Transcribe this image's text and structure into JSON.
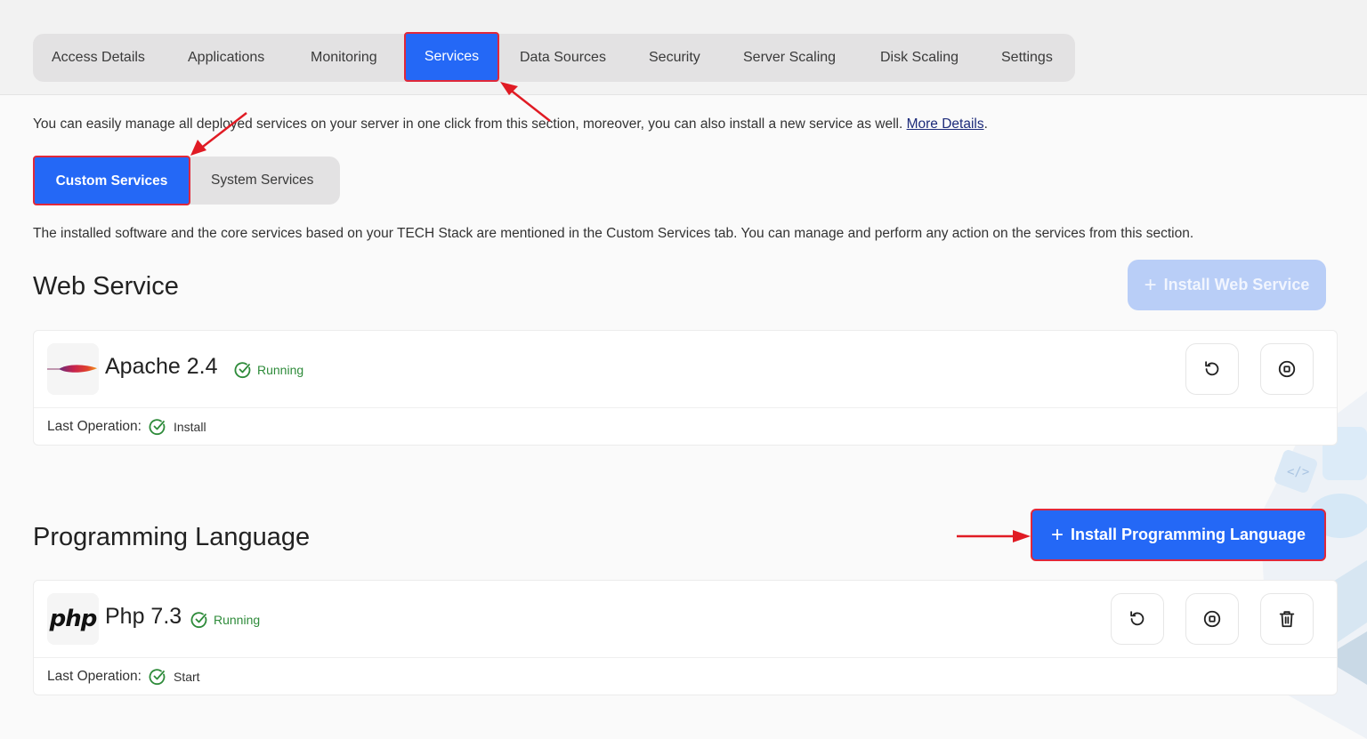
{
  "tabs": [
    {
      "label": "Access Details",
      "active": false
    },
    {
      "label": "Applications",
      "active": false
    },
    {
      "label": "Monitoring",
      "active": false
    },
    {
      "label": "Services",
      "active": true
    },
    {
      "label": "Data Sources",
      "active": false
    },
    {
      "label": "Security",
      "active": false
    },
    {
      "label": "Server Scaling",
      "active": false
    },
    {
      "label": "Disk Scaling",
      "active": false
    },
    {
      "label": "Settings",
      "active": false
    }
  ],
  "intro": {
    "text": "You can easily manage all deployed services on your server in one click from this section, moreover, you can also install a new service as well.",
    "link": "More Details",
    "suffix": "."
  },
  "subtabs": [
    {
      "label": "Custom Services",
      "active": true
    },
    {
      "label": "System Services",
      "active": false
    }
  ],
  "description": "The installed software and the core services based on your TECH Stack are mentioned in the Custom Services tab. You can manage and perform any action on the services from this section.",
  "sections": {
    "web": {
      "title": "Web Service",
      "install_button": "Install Web Service",
      "install_disabled": true,
      "service": {
        "name": "Apache 2.4",
        "logo": "apache-feather-icon",
        "status": "Running",
        "last_operation_label": "Last Operation:",
        "last_operation": "Install",
        "actions": [
          "restart",
          "stop"
        ]
      }
    },
    "language": {
      "title": "Programming Language",
      "install_button": "Install Programming Language",
      "service": {
        "name": "Php 7.3",
        "logo": "php-logo-icon",
        "logo_text": "php",
        "status": "Running",
        "last_operation_label": "Last Operation:",
        "last_operation": "Start",
        "actions": [
          "restart",
          "stop",
          "delete"
        ]
      }
    }
  },
  "colors": {
    "accent": "#2468f6",
    "highlight": "#e0283a",
    "success": "#2e8b3a",
    "disabled_button": "#b9cef7"
  }
}
